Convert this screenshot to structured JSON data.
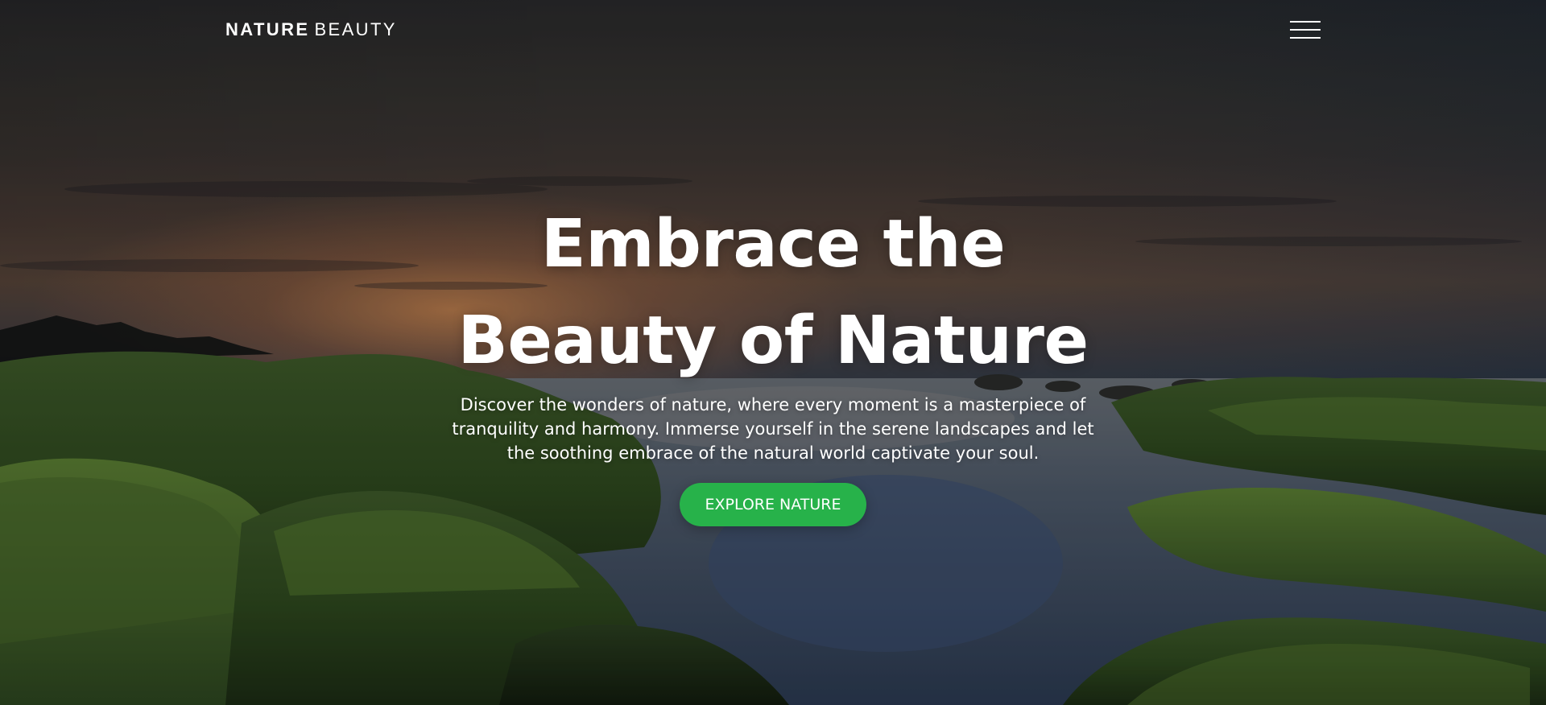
{
  "header": {
    "brand_bold": "NATURE",
    "brand_light": "BEAUTY",
    "menu_icon": "hamburger-menu-icon"
  },
  "hero": {
    "title_line1": "Embrace the",
    "title_line2": "Beauty of Nature",
    "subtitle": "Discover the wonders of nature, where every moment is a masterpiece of tranquility and harmony. Immerse yourself in the serene landscapes and let the soothing embrace of the natural world captivate your soul.",
    "cta_label": "EXPLORE NATURE",
    "background_description": "Sunset over moss-covered rocks and a calm tidal pool"
  },
  "colors": {
    "accent": "#27b24a",
    "text": "#ffffff"
  }
}
